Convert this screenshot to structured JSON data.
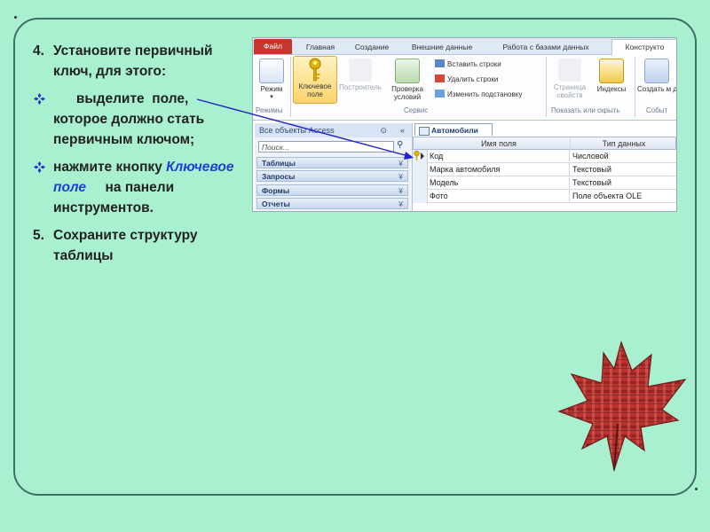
{
  "slide": {
    "instructions": [
      {
        "marker": "4.",
        "text": "Установите первичный ключ, для этого:"
      },
      {
        "marker": "❖",
        "text": "      выделите  поле, которое должно стать первичным ключом;"
      },
      {
        "marker": "❖",
        "text_before": "нажмите кнопку ",
        "highlight": "Ключевое поле",
        "text_after": "     на панели инструментов."
      },
      {
        "marker": "5.",
        "text": "Сохраните структуру таблицы"
      }
    ]
  },
  "access": {
    "tabs": [
      "Файл",
      "Главная",
      "Создание",
      "Внешние данные",
      "Работа с базами данных",
      "Конструкто"
    ],
    "ribbon": {
      "mode_label": "Режим",
      "mode_group": "Режимы",
      "key_field_label": "Ключевое поле",
      "builder_label": "Построитель",
      "validation_label": "Проверка условий",
      "insert_rows": "Вставить строки",
      "delete_rows": "Удалить строки",
      "change_lookup": "Изменить подстановку",
      "service_group": "Сервис",
      "property_sheet_label": "Страница свойств",
      "indexes_label": "Индексы",
      "show_hide_group": "Показать или скрыть",
      "create_macro_label": "Создать м данн",
      "events_group": "Событ"
    },
    "nav": {
      "title": "Все объекты Access",
      "search_placeholder": "Поиск...",
      "categories": [
        "Таблицы",
        "Запросы",
        "Формы",
        "Отчеты"
      ]
    },
    "table": {
      "tab_name": "Автомобили",
      "headers": [
        "Имя поля",
        "Тип данных"
      ],
      "rows": [
        {
          "field": "Код",
          "type": "Числовой",
          "primary_key": true
        },
        {
          "field": "Марка автомобиля",
          "type": "Текстовый"
        },
        {
          "field": "Модель",
          "type": "Текстовый"
        },
        {
          "field": "Фото",
          "type": "Поле объекта OLE"
        }
      ]
    }
  },
  "colors": {
    "background": "#a8f0d0",
    "frame": "#3f6f68",
    "file_tab": "#c4372c",
    "highlight_text": "#1f3fd0",
    "arrow": "#2222cc"
  }
}
